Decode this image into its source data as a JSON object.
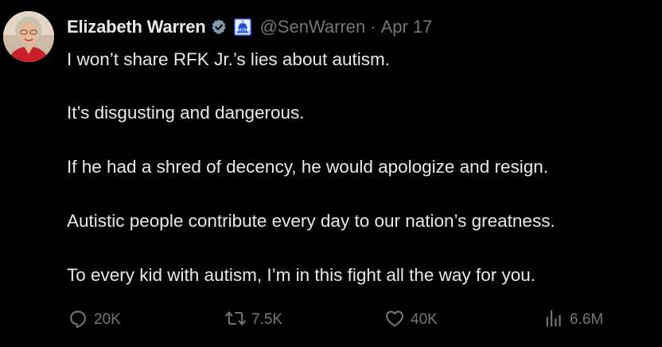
{
  "author": {
    "display_name": "Elizabeth Warren",
    "handle": "@SenWarren",
    "separator": "·",
    "date": "Apr 17",
    "verified_icon": "verified-badge-icon",
    "affiliation_icon": "capitol-building-icon"
  },
  "tweet": {
    "paragraphs": [
      "I won’t share RFK Jr.’s lies about autism.",
      "It’s disgusting and dangerous.",
      "If he had a shred of decency, he would apologize and resign.",
      "Autistic people contribute every day to our nation’s greatness.",
      "To every kid with autism, I’m in this fight all the way for you."
    ]
  },
  "metrics": {
    "replies": "20K",
    "reposts": "7.5K",
    "likes": "40K",
    "views": "6.6M"
  },
  "colors": {
    "background": "#000000",
    "text": "#e7e9ea",
    "muted": "#71767b",
    "affiliation_badge": "#1d4ed8"
  }
}
